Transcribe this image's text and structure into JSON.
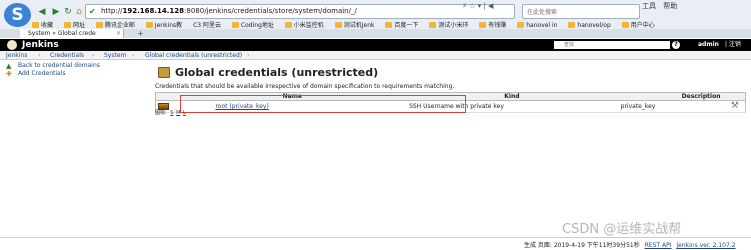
{
  "browser": {
    "url_prefix": "http://",
    "url_host": "192.168.14.128",
    "url_rest": ":8080/jenkins/credentials/store/system/domain/_/",
    "search_placeholder": "在此处搜索",
    "right_tools": [
      "工具",
      "帮助"
    ],
    "bookmarks": [
      "收藏",
      "网址",
      "腾讯企业邮",
      "Jenkins教",
      "C3 阿里云",
      "Coding地址",
      "小米监控机",
      "测试机Jenk",
      "百度一下",
      "测试小米环",
      "有钱赚",
      "hanovel in",
      "hanovel/op",
      "用户中心"
    ],
    "tab_title": "System » Global crede",
    "tab_add": "+"
  },
  "jenkins": {
    "title": "Jenkins",
    "search_placeholder": "查找",
    "help": "?",
    "user": "admin",
    "logout": "| 注销",
    "breadcrumbs": [
      "Jenkins",
      "Credentials",
      "System",
      "Global credentials (unrestricted)"
    ],
    "breadcrumb_sep": "›",
    "side": {
      "back": "Back to credential domains",
      "add": "Add Credentials"
    },
    "page_title": "Global credentials (unrestricted)",
    "description": "Credentials that should be available irrespective of domain specification to requirements matching.",
    "table": {
      "headers": [
        "Name",
        "Kind",
        "Description"
      ],
      "rows": [
        {
          "name": "root (private_key)",
          "kind": "SSH Username with private key",
          "description": "private_key"
        }
      ]
    },
    "icon_label": "图标:",
    "icon_sizes": [
      "S",
      "M",
      "L"
    ],
    "footer": {
      "generated": "生成 页面: 2019-4-19 下午11时39分51秒",
      "rest_api": "REST API",
      "version": "Jenkins ver. 2.107.2"
    }
  },
  "watermark": "CSDN @运维实战帮"
}
